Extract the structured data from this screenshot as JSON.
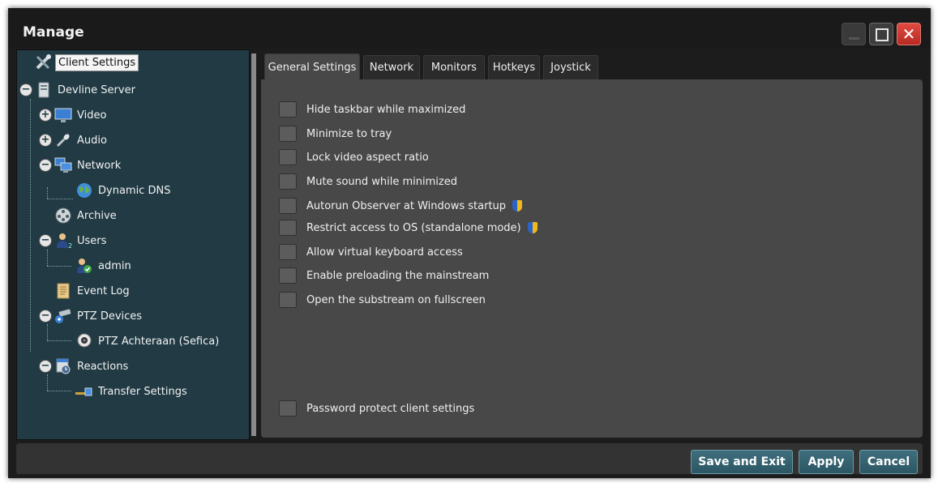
{
  "window": {
    "title": "Manage",
    "controls": {
      "minimize": "minimize-icon",
      "maximize": "maximize-icon",
      "close": "✕"
    }
  },
  "sidebar": {
    "items": [
      {
        "label": "Client Settings",
        "icon": "client-settings-icon",
        "selected": true
      },
      {
        "label": "Devline Server",
        "icon": "server-icon",
        "expander": "−"
      },
      {
        "label": "Video",
        "icon": "monitor-icon",
        "expander": "+"
      },
      {
        "label": "Audio",
        "icon": "microphone-icon",
        "expander": "+"
      },
      {
        "label": "Network",
        "icon": "network-icon",
        "expander": "−"
      },
      {
        "label": "Dynamic DNS",
        "icon": "globe-icon"
      },
      {
        "label": "Archive",
        "icon": "film-reel-icon"
      },
      {
        "label": "Users",
        "icon": "users-icon",
        "expander": "−"
      },
      {
        "label": "admin",
        "icon": "user-check-icon"
      },
      {
        "label": "Event Log",
        "icon": "document-icon"
      },
      {
        "label": "PTZ Devices",
        "icon": "ptz-camera-icon",
        "expander": "−"
      },
      {
        "label": "PTZ Achteraan (Sefica)",
        "icon": "webcam-icon"
      },
      {
        "label": "Reactions",
        "icon": "reactions-icon",
        "expander": "−"
      },
      {
        "label": "Transfer Settings",
        "icon": "transfer-icon"
      }
    ]
  },
  "tabs": [
    {
      "label": "General Settings",
      "active": true
    },
    {
      "label": "Network"
    },
    {
      "label": "Monitors"
    },
    {
      "label": "Hotkeys"
    },
    {
      "label": "Joystick"
    }
  ],
  "general": {
    "options": [
      {
        "label": "Hide taskbar while maximized",
        "checked": false
      },
      {
        "label": "Minimize to tray",
        "checked": false
      },
      {
        "label": "Lock video aspect ratio",
        "checked": false
      },
      {
        "label": "Mute sound while minimized",
        "checked": false
      },
      {
        "label": "Autorun Observer at Windows startup",
        "checked": false,
        "icon": "uac-shield-icon"
      },
      {
        "label": "Restrict access to OS (standalone mode)",
        "checked": false,
        "icon": "uac-shield-icon"
      },
      {
        "label": "Allow virtual keyboard access",
        "checked": false
      },
      {
        "label": "Enable preloading the mainstream",
        "checked": false
      },
      {
        "label": "Open the substream on fullscreen",
        "checked": false
      }
    ],
    "password_protect": {
      "label": "Password protect client settings",
      "checked": false
    }
  },
  "buttons": {
    "save_exit": "Save and Exit",
    "apply": "Apply",
    "cancel": "Cancel"
  },
  "colors": {
    "window_bg": "#1c1c1c",
    "sidebar_bg": "#213a44",
    "panel_bg": "#484848",
    "button_bg": "#2c5663",
    "close_red": "#c8342b"
  }
}
